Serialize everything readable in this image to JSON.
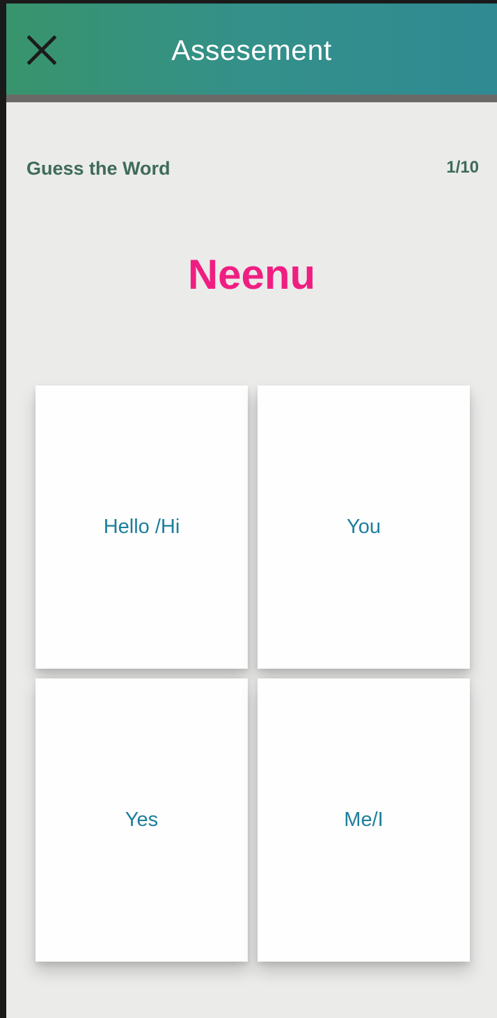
{
  "app_bar": {
    "title": "Assesement",
    "close_icon": "close-icon"
  },
  "quiz": {
    "prompt": "Guess the Word",
    "progress": "1/10",
    "word": "Neenu",
    "options": [
      {
        "label": "Hello /Hi"
      },
      {
        "label": "You"
      },
      {
        "label": "Yes"
      },
      {
        "label": "Me/I"
      }
    ]
  },
  "colors": {
    "header": "#34908a",
    "word": "#ef1f82",
    "option_text": "#1d7e9c",
    "subtitle": "#3e6b57"
  }
}
